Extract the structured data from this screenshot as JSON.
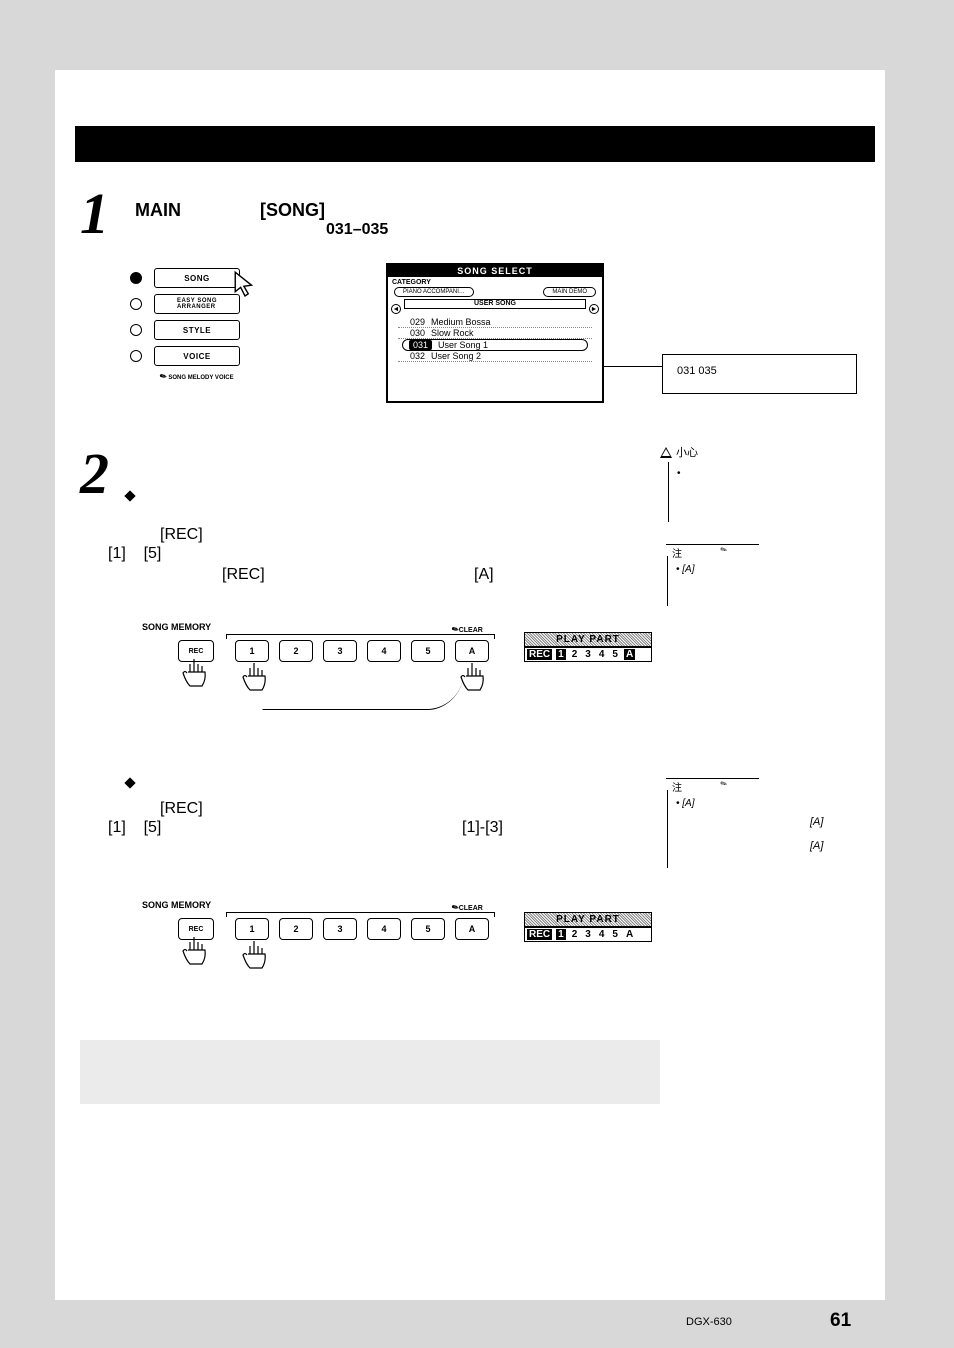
{
  "page": {
    "model": "DGX-630",
    "number": "61"
  },
  "step1": {
    "num": "1",
    "main": "MAIN",
    "song": "[SONG]",
    "range": "031–035",
    "modes": {
      "song": "SONG",
      "easy": "EASY SONG\nARRANGER",
      "style": "STYLE",
      "voice": "VOICE",
      "smv": "SONG MELODY VOICE"
    },
    "lcd": {
      "title": "SONG SELECT",
      "category": "CATEGORY",
      "tab_left": "PIANO ACCOMPANI…",
      "tab_right": "MAIN DEMO",
      "sub": "USER SONG",
      "rows": [
        {
          "n": "029",
          "t": "Medium Bossa"
        },
        {
          "n": "030",
          "t": "Slow Rock"
        },
        {
          "n": "031",
          "t": "User Song 1"
        },
        {
          "n": "032",
          "t": "User Song 2"
        }
      ]
    },
    "note_range": "031   035"
  },
  "step2": {
    "num": "2",
    "rec": "[REC]",
    "nums": "[1]    [5]",
    "rec2": "[REC]",
    "a": "[A]",
    "caution_label": "小心",
    "note_label": "注",
    "note1_a": "[A]",
    "sub2_nums": "[1]    [5]",
    "sub2_range": "[1]-[3]",
    "note2_a1": "[A]",
    "note2_right_a1": "[A]",
    "note2_right_a2": "[A]"
  },
  "songmem": {
    "label": "SONG MEMORY",
    "rec": "REC",
    "b1": "1",
    "b2": "2",
    "b3": "3",
    "b4": "4",
    "b5": "5",
    "bA": "A",
    "clear": "CLEAR"
  },
  "playpart": {
    "title": "PLAY PART",
    "rec": "REC",
    "n1": "1",
    "n2": "2",
    "n3": "3",
    "n4": "4",
    "n5": "5",
    "nA": "A"
  }
}
